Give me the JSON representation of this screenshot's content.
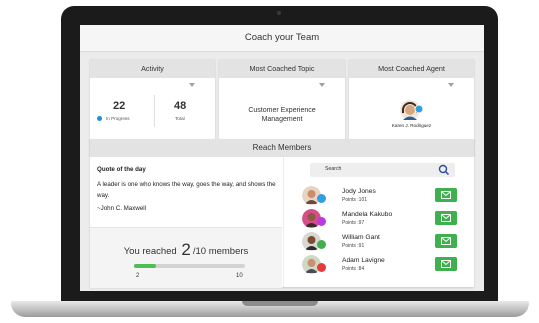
{
  "app": {
    "title": "Coach your Team"
  },
  "activity": {
    "title": "Activity",
    "in_progress_count": "22",
    "in_progress_label": "In Progress",
    "total_count": "48",
    "total_label": "Total"
  },
  "topic": {
    "title": "Most Coached Topic",
    "value": "Customer Experience Management"
  },
  "agent": {
    "title": "Most Coached Agent",
    "name": "Karen J. Rodriguez"
  },
  "reach": {
    "title": "Reach Members",
    "quote_title": "Quote of  the  day",
    "quote_text": "A leader is one who knows the way,  goes the way, and shows the way.",
    "quote_author": "~John C. Maxwell",
    "reached_prefix": "You reached",
    "reached_count": "2",
    "reached_suffix": "/10 members",
    "progress": 0.2,
    "progress_min": "2",
    "progress_max": "10"
  },
  "search": {
    "placeholder": "Search"
  },
  "members": [
    {
      "name": "Jody Jones",
      "points": "Points :101",
      "badge_color": "#2fa0e0"
    },
    {
      "name": "Mandela Kakubo",
      "points": "Points :97",
      "badge_color": "#b83be0"
    },
    {
      "name": "William Gant",
      "points": "Points :91",
      "badge_color": "#3fb04e"
    },
    {
      "name": "Adam Lavigne",
      "points": "Points :84",
      "badge_color": "#e43a3a"
    }
  ],
  "colors": {
    "accent_green": "#3fb04e",
    "in_progress_dot": "#1d8fdb"
  }
}
